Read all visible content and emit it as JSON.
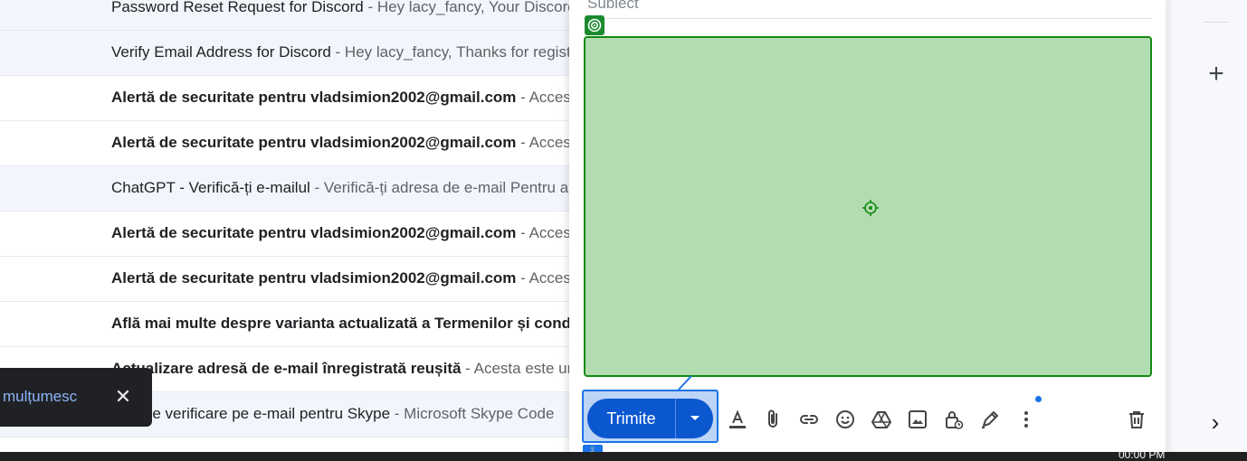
{
  "emails": [
    {
      "subject": "Password Reset Request for Discord",
      "snippet": " - Hey lacy_fancy, Your Discord password can be reset by clicking",
      "unread": false
    },
    {
      "subject": "Verify Email Address for Discord",
      "snippet": " - Hey lacy_fancy, Thanks for registering",
      "unread": false
    },
    {
      "subject": "Alertă de securitate pentru vladsimion2002@gmail.com",
      "snippet": " - Acces nou",
      "unread": true
    },
    {
      "subject": "Alertă de securitate pentru vladsimion2002@gmail.com",
      "snippet": " - Acces nou",
      "unread": true
    },
    {
      "subject": "ChatGPT - Verifică-ți e-mailul",
      "snippet": " - Verifică-ți adresa de e-mail Pentru a",
      "unread": false
    },
    {
      "subject": "Alertă de securitate pentru vladsimion2002@gmail.com",
      "snippet": " - Acces nou",
      "unread": true
    },
    {
      "subject": "Alertă de securitate pentru vladsimion2002@gmail.com",
      "snippet": " - Acces nou",
      "unread": true
    },
    {
      "subject": "Află mai multe despre varianta actualizată a Termenilor și condițiilor",
      "snippet": "",
      "unread": true
    },
    {
      "subject": "Actualizare adresă de e-mail înregistrată reușită",
      "snippet": " - Acesta este un mesaj",
      "unread": true
    },
    {
      "subject": "Cod de verificare pe e-mail pentru Skype",
      "snippet": " - Microsoft Skype Code",
      "unread": false
    }
  ],
  "compose": {
    "subject_placeholder": "Subiect",
    "send_label": "Trimite",
    "toolbar": [
      "formatting-options-icon",
      "attach-file-icon",
      "insert-link-icon",
      "emoji-icon",
      "google-drive-icon",
      "insert-photo-icon",
      "confidential-mode-icon",
      "signature-icon",
      "more-options-icon",
      "discard-draft-icon"
    ]
  },
  "snackbar": {
    "text": "mulțumesc",
    "close_symbol": "✕"
  },
  "side_panel": {
    "add_symbol": "+",
    "expand_symbol": "›"
  },
  "taskbar": {
    "clock": "00:00 PM"
  },
  "colors": {
    "send_button": "#0b57d0",
    "body_highlight": "#b3dcb3",
    "body_border": "#128a12",
    "snackbar_bg": "#202124",
    "snackbar_link": "#8ab4f8"
  }
}
